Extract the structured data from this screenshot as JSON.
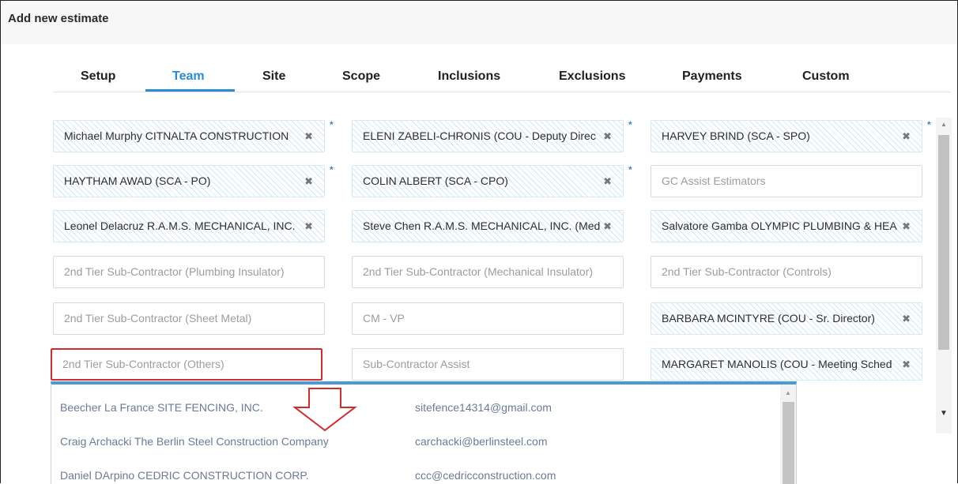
{
  "header": {
    "title": "Add new estimate"
  },
  "tabs": [
    {
      "label": "Setup",
      "active": false
    },
    {
      "label": "Team",
      "active": true
    },
    {
      "label": "Site",
      "active": false
    },
    {
      "label": "Scope",
      "active": false
    },
    {
      "label": "Inclusions",
      "active": false
    },
    {
      "label": "Exclusions",
      "active": false
    },
    {
      "label": "Payments",
      "active": false
    },
    {
      "label": "Custom",
      "active": false
    }
  ],
  "fields": [
    {
      "text": "Michael Murphy CITNALTA CONSTRUCTION",
      "filled": true,
      "required": true
    },
    {
      "text": "ELENI ZABELI-CHRONIS (COU - Deputy Direc",
      "filled": true,
      "required": true
    },
    {
      "text": "HARVEY BRIND (SCA - SPO)",
      "filled": true,
      "required": true
    },
    {
      "text": "HAYTHAM AWAD (SCA - PO)",
      "filled": true,
      "required": true
    },
    {
      "text": "COLIN ALBERT (SCA - CPO)",
      "filled": true,
      "required": true
    },
    {
      "text": "GC Assist Estimators",
      "filled": false,
      "required": false
    },
    {
      "text": "Leonel Delacruz R.A.M.S. MECHANICAL, INC.",
      "filled": true,
      "required": false
    },
    {
      "text": "Steve Chen R.A.M.S. MECHANICAL, INC. (Med",
      "filled": true,
      "required": false
    },
    {
      "text": "Salvatore Gamba OLYMPIC PLUMBING & HEA",
      "filled": true,
      "required": false
    },
    {
      "text": "2nd Tier Sub-Contractor (Plumbing Insulator)",
      "filled": false,
      "required": false
    },
    {
      "text": "2nd Tier Sub-Contractor (Mechanical Insulator)",
      "filled": false,
      "required": false
    },
    {
      "text": "2nd Tier Sub-Contractor (Controls)",
      "filled": false,
      "required": false
    },
    {
      "text": "2nd Tier Sub-Contractor (Sheet Metal)",
      "filled": false,
      "required": false
    },
    {
      "text": "CM - VP",
      "filled": false,
      "required": false
    },
    {
      "text": "BARBARA MCINTYRE (COU - Sr. Director)",
      "filled": true,
      "required": false
    },
    {
      "text": "2nd Tier Sub-Contractor (Others)",
      "filled": false,
      "required": false,
      "highlighted": true
    },
    {
      "text": "Sub-Contractor Assist",
      "filled": false,
      "required": false
    },
    {
      "text": "MARGARET MANOLIS (COU - Meeting Sched",
      "filled": true,
      "required": false
    }
  ],
  "icons": {
    "remove": "✖",
    "required": "*",
    "scroll_up": "▲",
    "scroll_down": "▼"
  },
  "dropdown": {
    "options": [
      {
        "name": "Beecher La France SITE FENCING, INC.",
        "email": "sitefence14314@gmail.com"
      },
      {
        "name": "Craig Archacki The Berlin Steel Construction Company",
        "email": "carchacki@berlinsteel.com"
      },
      {
        "name": "Daniel DArpino CEDRIC CONSTRUCTION CORP.",
        "email": "ccc@cedricconstruction.com"
      }
    ]
  },
  "colors": {
    "accent": "#2a8bd6",
    "required_star": "#3a87c8",
    "highlight_border": "#d22b2b",
    "dropdown_top_border": "#4a9ad5",
    "option_text": "#6b7a99"
  }
}
